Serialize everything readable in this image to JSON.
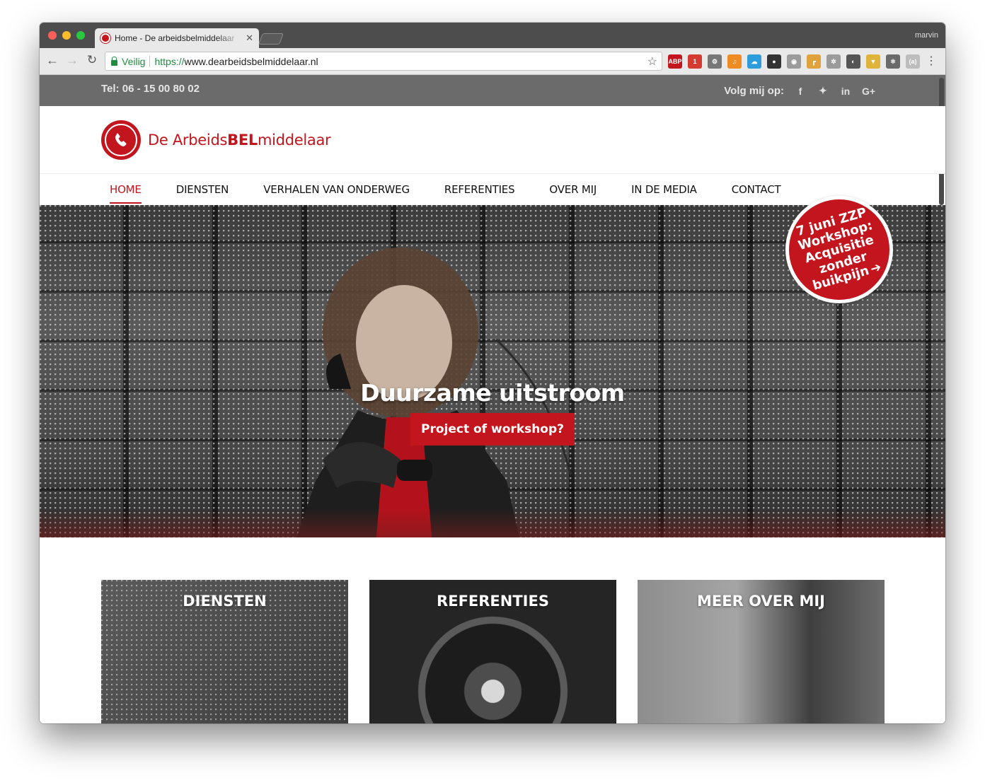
{
  "browser": {
    "tab_title": "Home - De arbeidsbelmiddelaar",
    "profile_name": "marvin",
    "security_label": "Veilig",
    "url_scheme": "https://",
    "url_host": "www.dearbeidsbelmiddelaar.nl",
    "extensions": [
      {
        "name": "adblock-icon",
        "label": "ABP",
        "color": "#c3151d"
      },
      {
        "name": "calendar-icon",
        "label": "1",
        "color": "#d43a2f"
      },
      {
        "name": "gear-icon",
        "label": "⚙",
        "color": "#777777"
      },
      {
        "name": "music-icon",
        "label": "♫",
        "color": "#f08a24"
      },
      {
        "name": "weather-icon",
        "label": "☁",
        "color": "#2d9cdb"
      },
      {
        "name": "spy-icon",
        "label": "●",
        "color": "#333333"
      },
      {
        "name": "camera-icon",
        "label": "◉",
        "color": "#9b9b9b"
      },
      {
        "name": "tag-icon",
        "label": "┏",
        "color": "#e0a23a"
      },
      {
        "name": "settings-icon",
        "label": "✲",
        "color": "#9b9b9b"
      },
      {
        "name": "circle-icon",
        "label": "◐",
        "color": "#555555"
      },
      {
        "name": "shield-icon",
        "label": "▼",
        "color": "#e0b43a"
      },
      {
        "name": "atom-icon",
        "label": "⚛",
        "color": "#6a6a6a"
      },
      {
        "name": "placeholder-icon",
        "label": "(a)",
        "color": "#bdbdbd"
      }
    ]
  },
  "topbar": {
    "phone": "Tel: 06 - 15 00 80 02",
    "follow_label": "Volg mij op:",
    "social": [
      {
        "name": "facebook-icon",
        "glyph": "f"
      },
      {
        "name": "twitter-icon",
        "glyph": "🐦"
      },
      {
        "name": "linkedin-icon",
        "glyph": "in"
      },
      {
        "name": "google-plus-icon",
        "glyph": "G+"
      }
    ]
  },
  "logo": {
    "prefix": "De Arbeids",
    "bold": "BEL",
    "suffix": "middelaar"
  },
  "nav": [
    {
      "label": "HOME",
      "active": true
    },
    {
      "label": "DIENSTEN",
      "active": false
    },
    {
      "label": "VERHALEN VAN ONDERWEG",
      "active": false
    },
    {
      "label": "REFERENTIES",
      "active": false
    },
    {
      "label": "OVER MIJ",
      "active": false
    },
    {
      "label": "IN DE MEDIA",
      "active": false
    },
    {
      "label": "CONTACT",
      "active": false
    }
  ],
  "badge": {
    "line1": "7 juni ZZP",
    "line2": "Workshop:",
    "line3": "Acquisitie",
    "line4": "zonder",
    "line5": "buikpijn"
  },
  "hero": {
    "title": "Duurzame uitstroom",
    "button": "Project of workshop?"
  },
  "cards": [
    {
      "title": "DIENSTEN"
    },
    {
      "title": "REFERENTIES"
    },
    {
      "title": "MEER OVER MIJ"
    }
  ],
  "colors": {
    "brand_red": "#c3151d",
    "topbar_gray": "#6b6b6b"
  }
}
